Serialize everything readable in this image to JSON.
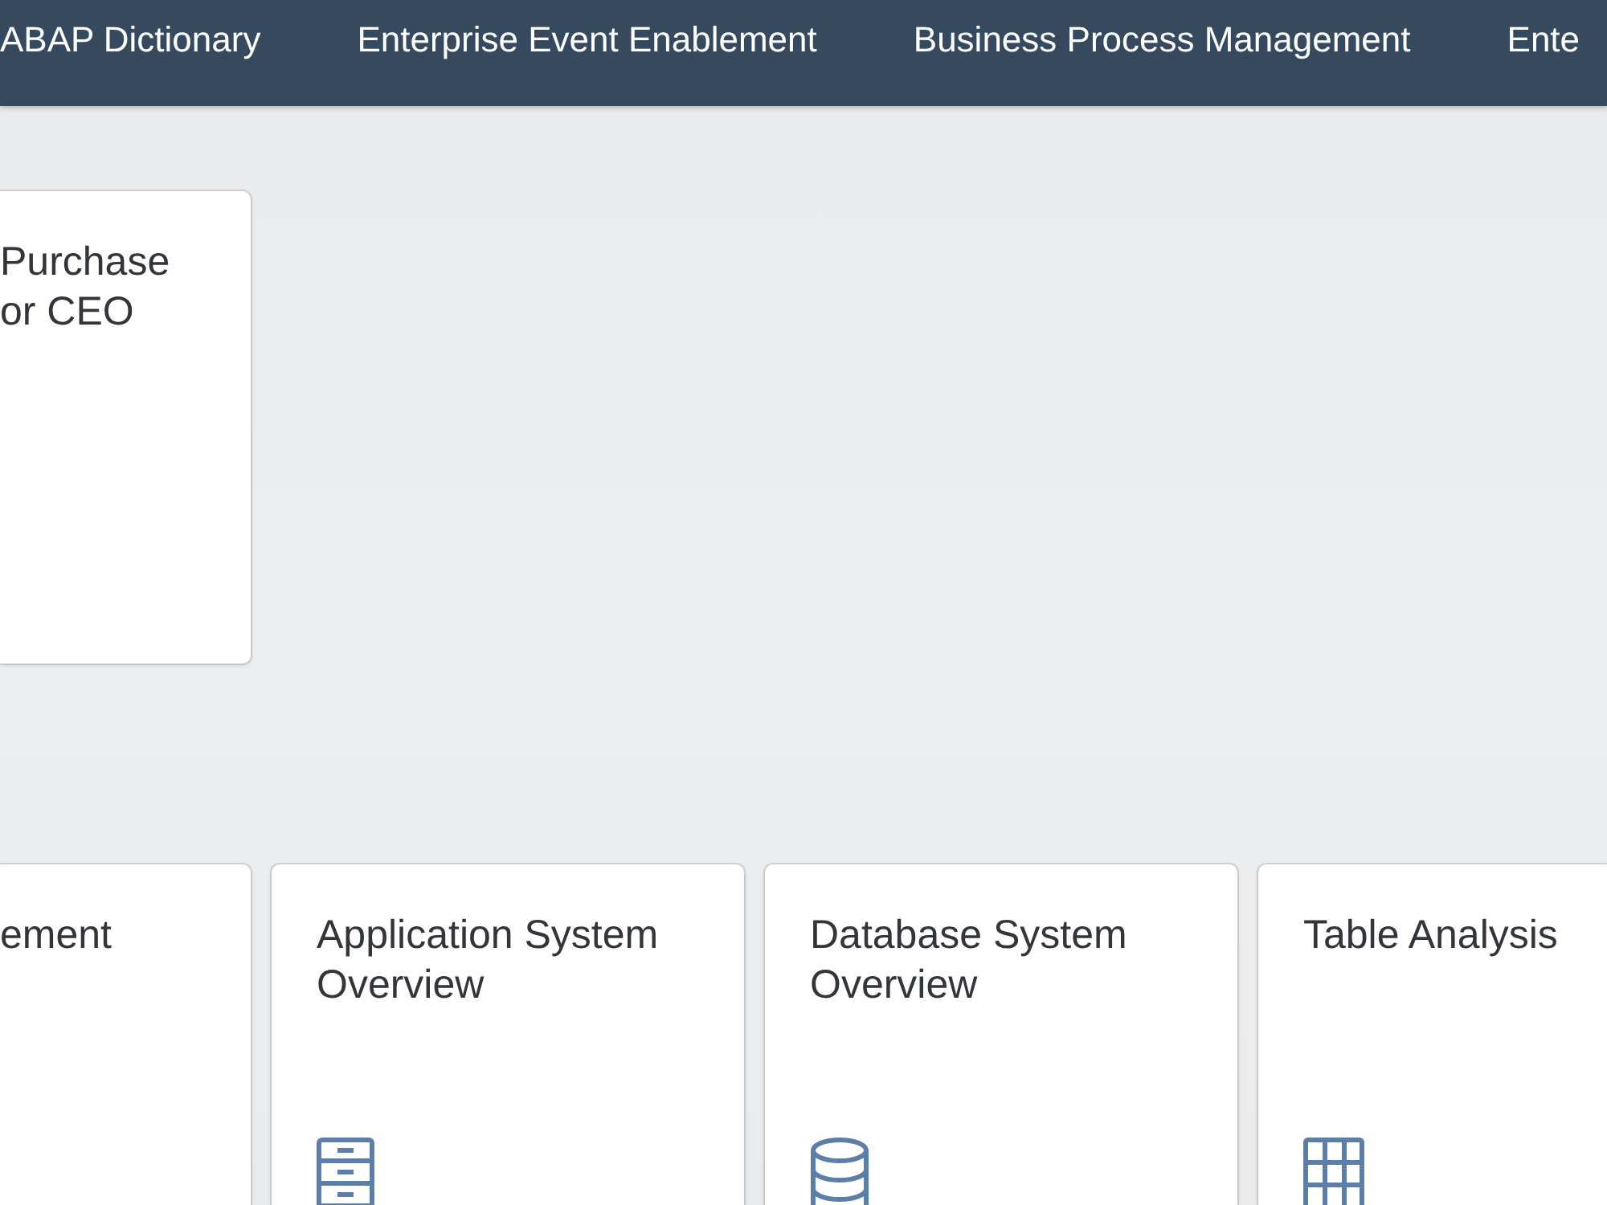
{
  "anchor_bar": {
    "items": [
      {
        "label": "ABAP Dictionary",
        "selected": false
      },
      {
        "label": "Enterprise Event Enablement",
        "selected": false
      },
      {
        "label": "Business Process Management",
        "selected": false
      },
      {
        "label": "Ente",
        "selected": false
      }
    ]
  },
  "sections": [
    {
      "tiles": [
        {
          "kind": "plain",
          "title": "Purchase or CEO"
        }
      ]
    },
    {
      "tiles": [
        {
          "kind": "plain",
          "title": "ement"
        },
        {
          "kind": "cabinet",
          "title": "Application System Overview"
        },
        {
          "kind": "database",
          "title": "Database System Overview"
        },
        {
          "kind": "grid",
          "title": "Table Analysis"
        }
      ]
    }
  ]
}
